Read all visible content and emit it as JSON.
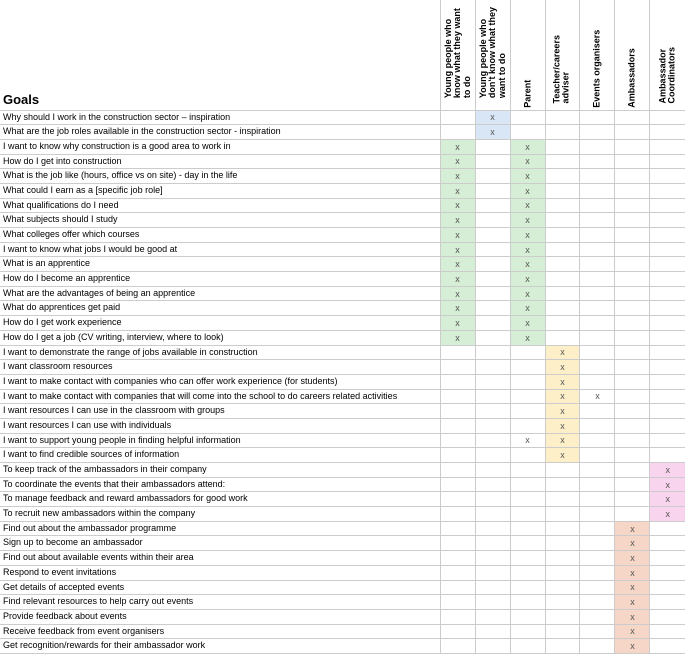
{
  "title": "Goals",
  "mark_glyph": "x",
  "audiences": [
    {
      "key": "yp_know",
      "label": "Young people who know what they want to do"
    },
    {
      "key": "yp_dont",
      "label": "Young people who don't know what they want to do"
    },
    {
      "key": "parent",
      "label": "Parent"
    },
    {
      "key": "teacher",
      "label": "Teacher/careers adviser"
    },
    {
      "key": "events",
      "label": "Events organisers"
    },
    {
      "key": "ambassadors",
      "label": "Ambassadors"
    },
    {
      "key": "ambcoord",
      "label": "Ambassador Coordinators"
    }
  ],
  "chart_data": {
    "type": "table",
    "columns": [
      "Young people who know what they want to do",
      "Young people who don't know what they want to do",
      "Parent",
      "Teacher/careers adviser",
      "Events organisers",
      "Ambassadors",
      "Ambassador Coordinators"
    ],
    "rows": [
      {
        "label": "Why should I work in the construction sector – inspiration",
        "cells": {
          "yp_dont": {
            "mark": true,
            "shade": "blue"
          }
        }
      },
      {
        "label": "What are the job roles available in the construction sector - inspiration",
        "cells": {
          "yp_dont": {
            "mark": true,
            "shade": "blue"
          }
        }
      },
      {
        "label": "I want to know why construction is a good area to work in",
        "cells": {
          "yp_know": {
            "mark": true,
            "shade": "green"
          },
          "parent": {
            "mark": true,
            "shade": "green"
          }
        }
      },
      {
        "label": "How do I get into construction",
        "cells": {
          "yp_know": {
            "mark": true,
            "shade": "green"
          },
          "parent": {
            "mark": true,
            "shade": "green"
          }
        }
      },
      {
        "label": "What is the job like (hours, office vs on site) - day in the life",
        "cells": {
          "yp_know": {
            "mark": true,
            "shade": "green"
          },
          "parent": {
            "mark": true,
            "shade": "green"
          }
        }
      },
      {
        "label": "What could I earn as a [specific job role]",
        "cells": {
          "yp_know": {
            "mark": true,
            "shade": "green"
          },
          "parent": {
            "mark": true,
            "shade": "green"
          }
        }
      },
      {
        "label": "What qualifications do I need",
        "cells": {
          "yp_know": {
            "mark": true,
            "shade": "green"
          },
          "parent": {
            "mark": true,
            "shade": "green"
          }
        }
      },
      {
        "label": "What subjects should I study",
        "cells": {
          "yp_know": {
            "mark": true,
            "shade": "green"
          },
          "parent": {
            "mark": true,
            "shade": "green"
          }
        }
      },
      {
        "label": "What colleges offer which courses",
        "cells": {
          "yp_know": {
            "mark": true,
            "shade": "green"
          },
          "parent": {
            "mark": true,
            "shade": "green"
          }
        }
      },
      {
        "label": "I want to know what jobs I would be good at",
        "cells": {
          "yp_know": {
            "mark": true,
            "shade": "green"
          },
          "parent": {
            "mark": true,
            "shade": "green"
          }
        }
      },
      {
        "label": "What is an apprentice",
        "cells": {
          "yp_know": {
            "mark": true,
            "shade": "green"
          },
          "parent": {
            "mark": true,
            "shade": "green"
          }
        }
      },
      {
        "label": "How do I become an apprentice",
        "cells": {
          "yp_know": {
            "mark": true,
            "shade": "green"
          },
          "parent": {
            "mark": true,
            "shade": "green"
          }
        }
      },
      {
        "label": "What are the advantages of being an apprentice",
        "cells": {
          "yp_know": {
            "mark": true,
            "shade": "green"
          },
          "parent": {
            "mark": true,
            "shade": "green"
          }
        }
      },
      {
        "label": "What do apprentices get paid",
        "cells": {
          "yp_know": {
            "mark": true,
            "shade": "green"
          },
          "parent": {
            "mark": true,
            "shade": "green"
          }
        }
      },
      {
        "label": "How do I get work experience",
        "cells": {
          "yp_know": {
            "mark": true,
            "shade": "green"
          },
          "parent": {
            "mark": true,
            "shade": "green"
          }
        }
      },
      {
        "label": "How do I get a job (CV writing, interview, where to look)",
        "cells": {
          "yp_know": {
            "mark": true,
            "shade": "green"
          },
          "parent": {
            "mark": true,
            "shade": "green"
          }
        }
      },
      {
        "label": "I want to demonstrate the range of jobs available in construction",
        "cells": {
          "teacher": {
            "mark": true,
            "shade": "yellow"
          }
        }
      },
      {
        "label": "I want classroom resources",
        "cells": {
          "teacher": {
            "mark": true,
            "shade": "yellow"
          }
        }
      },
      {
        "label": "I want to make contact with companies who can offer work experience (for students)",
        "cells": {
          "teacher": {
            "mark": true,
            "shade": "yellow"
          }
        }
      },
      {
        "label": "I want to make contact with companies that will come into the school to do careers related activities",
        "cells": {
          "teacher": {
            "mark": true,
            "shade": "yellow"
          },
          "events": {
            "mark": true
          }
        }
      },
      {
        "label": "I want resources I can use in the classroom with groups",
        "cells": {
          "teacher": {
            "mark": true,
            "shade": "yellow"
          }
        }
      },
      {
        "label": "I want resources I can use with individuals",
        "cells": {
          "teacher": {
            "mark": true,
            "shade": "yellow"
          }
        }
      },
      {
        "label": "I want to support young people in finding helpful information",
        "cells": {
          "parent": {
            "mark": true
          },
          "teacher": {
            "mark": true,
            "shade": "yellow"
          }
        }
      },
      {
        "label": "I want to find credible sources of information",
        "cells": {
          "teacher": {
            "mark": true,
            "shade": "yellow"
          }
        }
      },
      {
        "label": "To keep track of the ambassadors in their company",
        "cells": {
          "ambcoord": {
            "mark": true,
            "shade": "pink"
          }
        }
      },
      {
        "label": "To coordinate the events that their ambassadors attend:",
        "cells": {
          "ambcoord": {
            "mark": true,
            "shade": "pink"
          }
        }
      },
      {
        "label": "To manage feedback and reward ambassadors for good work",
        "cells": {
          "ambcoord": {
            "mark": true,
            "shade": "pink"
          }
        }
      },
      {
        "label": "To recruit new ambassadors within the company",
        "cells": {
          "ambcoord": {
            "mark": true,
            "shade": "pink"
          }
        }
      },
      {
        "label": "Find out about the ambassador programme",
        "cells": {
          "ambassadors": {
            "mark": true,
            "shade": "peach"
          }
        }
      },
      {
        "label": "Sign up to become an ambassador",
        "cells": {
          "ambassadors": {
            "mark": true,
            "shade": "peach"
          }
        }
      },
      {
        "label": "Find out about available events within their area",
        "cells": {
          "ambassadors": {
            "mark": true,
            "shade": "peach"
          }
        }
      },
      {
        "label": "Respond to event invitations",
        "cells": {
          "ambassadors": {
            "mark": true,
            "shade": "peach"
          }
        }
      },
      {
        "label": "Get details of accepted events",
        "cells": {
          "ambassadors": {
            "mark": true,
            "shade": "peach"
          }
        }
      },
      {
        "label": "Find relevant resources to help carry out events",
        "cells": {
          "ambassadors": {
            "mark": true,
            "shade": "peach"
          }
        }
      },
      {
        "label": "Provide feedback about events",
        "cells": {
          "ambassadors": {
            "mark": true,
            "shade": "peach"
          }
        }
      },
      {
        "label": "Receive feedback from event organisers",
        "cells": {
          "ambassadors": {
            "mark": true,
            "shade": "peach"
          }
        }
      },
      {
        "label": "Get recognition/rewards for their ambassador work",
        "cells": {
          "ambassadors": {
            "mark": true,
            "shade": "peach"
          }
        }
      }
    ]
  }
}
